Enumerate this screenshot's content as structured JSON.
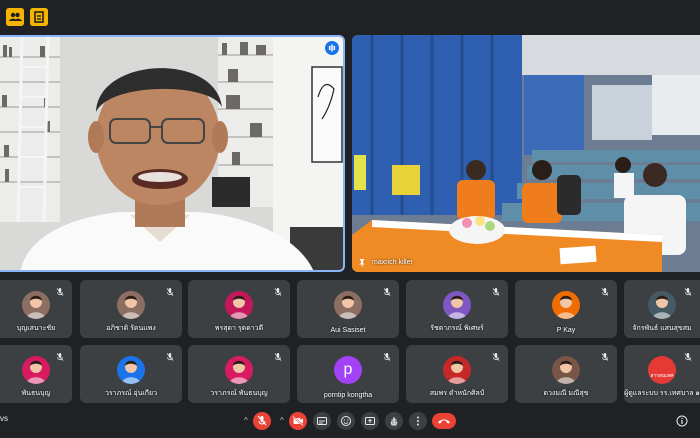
{
  "meeting": {
    "code_fragment": "vs"
  },
  "top_buttons": [
    {
      "icon": "users-icon",
      "color": "#f4b400"
    },
    {
      "icon": "activities-icon",
      "color": "#f4b400"
    }
  ],
  "main_tiles": [
    {
      "name": "",
      "speaking": true,
      "icon": "audio-wave-icon"
    },
    {
      "name": "maxrich killer",
      "icon": "pin-icon"
    }
  ],
  "participants_row1": [
    {
      "name": "บุญเสนาะชัย",
      "muted": true
    },
    {
      "name": "อภิชาติ รัตนแพง",
      "muted": true
    },
    {
      "name": "พรสุดา รุดดาวดี",
      "muted": true,
      "avatar_color": "#c2185b"
    },
    {
      "name": "Aui Sasiset",
      "muted": true
    },
    {
      "name": "รัชดาภรณ์ พิเศษร์",
      "muted": true,
      "avatar_color": "#7e57c2"
    },
    {
      "name": "P Kay",
      "muted": true,
      "avatar_color": "#ef6c00"
    },
    {
      "name": "จักรพันธ์ แสนสุขสม",
      "muted": true,
      "avatar_color": "#455a64"
    }
  ],
  "participants_row2": [
    {
      "name": "พันธนบุญ",
      "muted": true,
      "avatar_color": "#d81b60"
    },
    {
      "name": "วราภรณ์ อุ่นเกียว",
      "muted": true,
      "avatar_color": "#1a73e8"
    },
    {
      "name": "วราภรณ์ พันธนบุญ",
      "muted": true,
      "avatar_color": "#d81b60"
    },
    {
      "name": "porntip kongtha",
      "muted": true,
      "avatar_letter": "p",
      "avatar_color": "#a142f4"
    },
    {
      "name": "สมพร ดำหนักศิลป์",
      "muted": true,
      "avatar_color": "#c62828"
    },
    {
      "name": "ดวงมณี มณีสุข",
      "muted": true,
      "avatar_color": "#795548"
    },
    {
      "name": "ผู้ดูแลระบบ รร.เทศบาล ๑",
      "muted": true,
      "avatar_text": "สารสนเทศ",
      "avatar_color": "#e53935"
    }
  ],
  "controls": [
    {
      "icon": "mic-off-icon",
      "red": true
    },
    {
      "icon": "camera-off-icon",
      "red": true
    },
    {
      "icon": "captions-icon"
    },
    {
      "icon": "emoji-icon"
    },
    {
      "icon": "present-icon"
    },
    {
      "icon": "raise-hand-icon"
    },
    {
      "icon": "more-options-icon"
    },
    {
      "icon": "end-call-icon",
      "red": true
    }
  ]
}
